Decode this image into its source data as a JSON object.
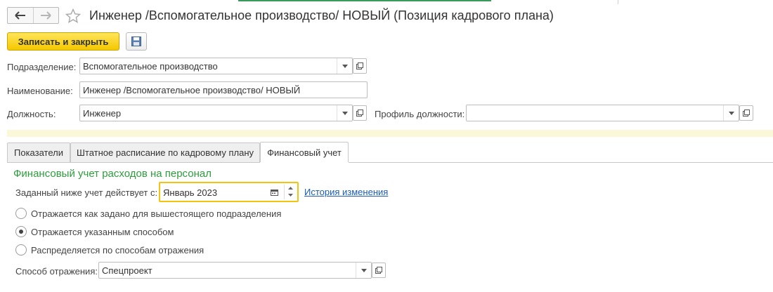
{
  "window": {
    "title": "Инженер /Вспомогательное производство/ НОВЫЙ (Позиция кадрового плана)"
  },
  "toolbar": {
    "write_close_label": "Записать и закрыть"
  },
  "form": {
    "department": {
      "label": "Подразделение:",
      "value": "Вспомогательное производство"
    },
    "name": {
      "label": "Наименование:",
      "value": "Инженер /Вспомогательное производство/ НОВЫЙ"
    },
    "position": {
      "label": "Должность:",
      "value": "Инженер"
    },
    "position_profile": {
      "label": "Профиль должности:",
      "value": ""
    }
  },
  "tabs": [
    {
      "label": "Показатели",
      "active": false
    },
    {
      "label": "Штатное расписание по кадровому плану",
      "active": false
    },
    {
      "label": "Финансовый учет",
      "active": true
    }
  ],
  "finance": {
    "section_title": "Финансовый учет расходов на персонал",
    "effective_label": "Заданный ниже учет действует с:",
    "effective_value": "Январь 2023",
    "history_link": "История изменения",
    "options": [
      {
        "label": "Отражается как задано для вышестоящего подразделения",
        "checked": false
      },
      {
        "label": "Отражается указанным способом",
        "checked": true
      },
      {
        "label": "Распределяется по способам отражения",
        "checked": false
      }
    ],
    "method": {
      "label": "Способ отражения:",
      "value": "Спецпроект"
    }
  },
  "colors": {
    "accent_green": "#2e9c3d",
    "primary_button": "#f4c800",
    "link": "#1c5bb8",
    "focus_border": "#f1c40f"
  },
  "icons": [
    "back-arrow-icon",
    "forward-arrow-icon",
    "star-icon",
    "floppy-disk-icon",
    "chevron-down-icon",
    "open-window-icon",
    "calendar-icon",
    "spin-up-icon",
    "spin-down-icon"
  ]
}
